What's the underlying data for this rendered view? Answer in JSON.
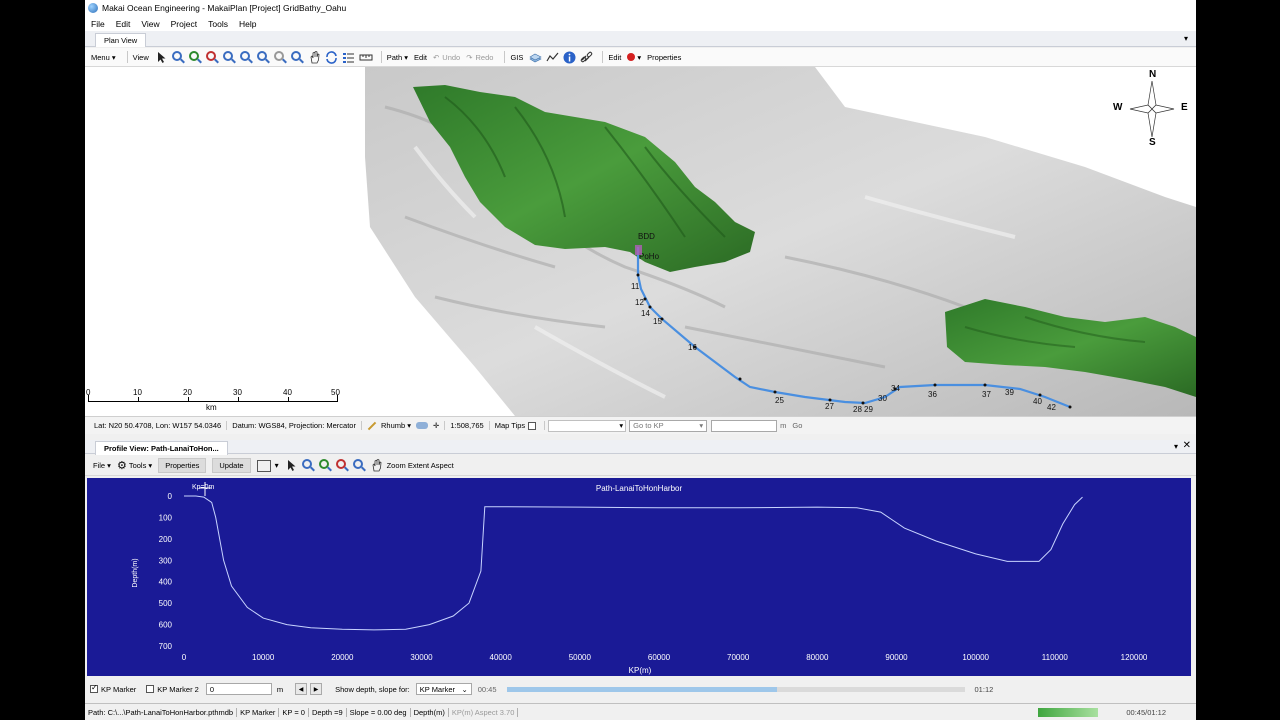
{
  "window": {
    "title": "Makai Ocean Engineering - MakaiPlan  [Project] GridBathy_Oahu"
  },
  "menubar": [
    "File",
    "Edit",
    "View",
    "Project",
    "Tools",
    "Help"
  ],
  "plan_view": {
    "tab": "Plan View",
    "toolbar": {
      "menu": "Menu",
      "view": "View",
      "path": "Path",
      "edit": "Edit",
      "undo": "Undo",
      "redo": "Redo",
      "gis": "GIS",
      "edit2": "Edit",
      "properties": "Properties"
    },
    "compass": {
      "n": "N",
      "s": "S",
      "e": "E",
      "w": "W"
    },
    "scalebar": {
      "ticks": [
        "0",
        "10",
        "20",
        "30",
        "40",
        "50"
      ],
      "unit": "km"
    },
    "route_labels": [
      "11",
      "12",
      "14",
      "15",
      "16",
      "25",
      "27",
      "28",
      "29",
      "30",
      "34",
      "36",
      "37",
      "39",
      "40",
      "42"
    ],
    "place_labels": [
      "BDD",
      "PoHo"
    ],
    "status": {
      "latlon": "Lat: N20 50.4708, Lon: W157 54.0346",
      "datum": "Datum: WGS84, Projection: Mercator",
      "rhumb": "Rhumb",
      "scale": "1:508,765",
      "maptips": "Map Tips",
      "goto_kp": "Go to KP",
      "m": "m",
      "go": "Go"
    }
  },
  "profile_view": {
    "tab": "Profile View: Path-LanaiToHon...",
    "toolbar": {
      "file": "File",
      "tools": "Tools",
      "properties": "Properties",
      "update": "Update",
      "zoom": "Zoom Extent Aspect"
    },
    "colors": {
      "bg": "#1a1a96",
      "line": "#c8d4ff"
    },
    "kp_marker_label": "Kp=0m",
    "chart_data": {
      "type": "line",
      "title": "Path-LanaiToHonHarbor",
      "xlabel": "KP(m)",
      "ylabel": "Depth(m)",
      "xlim": [
        0,
        120000
      ],
      "ylim": [
        0,
        700
      ],
      "y_inverted": true,
      "x_ticks": [
        "0",
        "10000",
        "20000",
        "30000",
        "40000",
        "50000",
        "60000",
        "70000",
        "80000",
        "90000",
        "100000",
        "110000",
        "120000"
      ],
      "y_ticks": [
        "0",
        "100",
        "200",
        "300",
        "400",
        "500",
        "600",
        "700"
      ],
      "series": [
        {
          "x": [
            0,
            1500,
            2500,
            3500,
            4000,
            5000,
            6000,
            8000,
            10000,
            13000,
            16000,
            20000,
            24000,
            28000,
            31000,
            34000,
            36000,
            37500,
            38000,
            40000,
            50000,
            60000,
            70000,
            80000,
            85000,
            88000,
            91000,
            95000,
            100000,
            104000,
            108000,
            109500,
            111000,
            112500,
            113500
          ],
          "y": [
            0,
            0,
            5,
            30,
            100,
            300,
            420,
            520,
            570,
            600,
            615,
            622,
            625,
            622,
            600,
            560,
            500,
            350,
            50,
            50,
            52,
            55,
            55,
            52,
            55,
            75,
            150,
            210,
            270,
            305,
            305,
            250,
            130,
            40,
            5
          ]
        }
      ]
    }
  },
  "bottom": {
    "kp_marker": "KP Marker",
    "kp_marker2": "KP Marker 2",
    "kp_input": "0",
    "unit_m": "m",
    "show_depth": "Show depth, slope for:",
    "select": "KP Marker",
    "time_start": "00:45",
    "time_end": "01:12",
    "progress": 0.59,
    "time_combined": "00:45/01:12"
  },
  "statusbar2": {
    "path": "Path: C:\\...\\Path-LanaiToHonHarbor.pthmdb",
    "kp_marker": "KP Marker",
    "kp": "KP = 0",
    "depth": "Depth =9",
    "slope": "Slope = 0.00 deg",
    "depth_unit": "Depth(m)",
    "aspect": "KP(m)  Aspect 3.70"
  }
}
